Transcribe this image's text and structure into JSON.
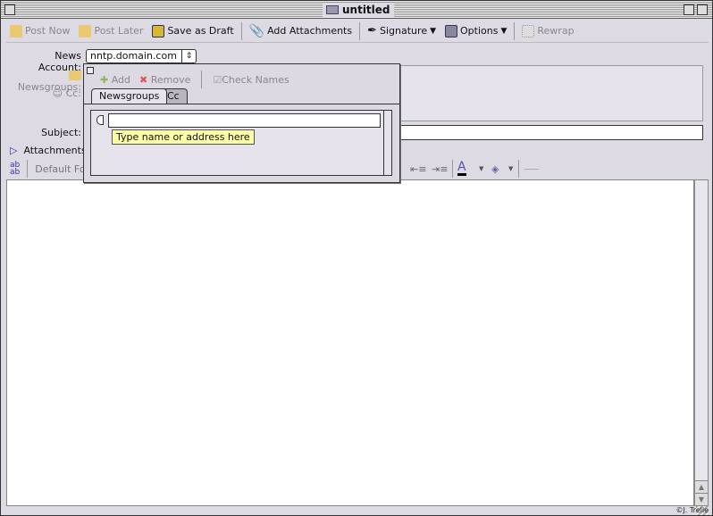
{
  "window": {
    "title": "untitled"
  },
  "toolbar": {
    "post_now": "Post Now",
    "post_later": "Post Later",
    "save_draft": "Save as Draft",
    "add_attachments": "Add Attachments",
    "signature": "Signature",
    "options": "Options",
    "rewrap": "Rewrap"
  },
  "header": {
    "news_account_label": "News Account:",
    "news_account_value": "nntp.domain.com",
    "newsgroups_label": "Newsgroups:",
    "cc_label": "Cc:",
    "subject_label": "Subject:",
    "subject_value": "",
    "attachments_label": "Attachments:"
  },
  "format": {
    "font_value": "Default Font"
  },
  "popup": {
    "add": "Add",
    "remove": "Remove",
    "check_names": "Check Names",
    "tabs": [
      {
        "label": "Newsgroups",
        "active": true
      },
      {
        "label": "Cc",
        "active": false
      }
    ],
    "entry_value": "",
    "tooltip": "Type name or address here"
  },
  "watermark": "©J. Trelle"
}
